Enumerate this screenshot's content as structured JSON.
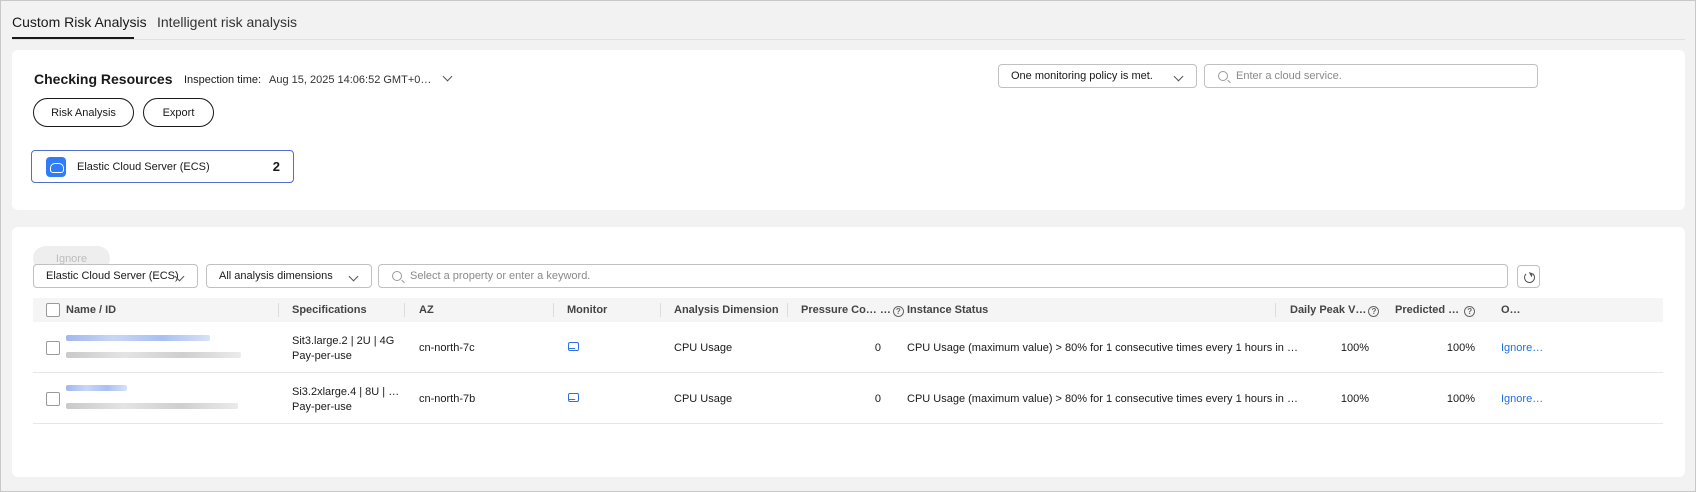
{
  "tabs": [
    {
      "label": "Custom Risk Analysis",
      "active": true
    },
    {
      "label": "Intelligent risk analysis",
      "active": false
    }
  ],
  "resources": {
    "title": "Checking Resources",
    "inspection_label": "Inspection time:",
    "inspection_time": "Aug 15, 2025 14:06:52 GMT+0…",
    "policy_select": "One monitoring policy is met.",
    "search_placeholder": "Enter a cloud service.",
    "risk_analysis_label": "Risk Analysis",
    "export_label": "Export",
    "service": {
      "name": "Elastic Cloud Server (ECS)",
      "count": "2",
      "icon": "cloud-server-icon"
    }
  },
  "list": {
    "ignore_label": "Ignore",
    "service_filter": "Elastic Cloud Server (ECS)",
    "dimension_filter": "All analysis dimensions",
    "search_placeholder": "Select a property or enter a keyword.",
    "columns": {
      "name": "Name / ID",
      "spec": "Specifications",
      "az": "AZ",
      "monitor": "Monitor",
      "dimension": "Analysis Dimension",
      "pressure": "Pressure Co… …",
      "status": "Instance Status",
      "daily_peak": "Daily Peak V…",
      "predicted": "Predicted …",
      "operation": "O…"
    },
    "rows": [
      {
        "spec_line1": "Sit3.large.2 | 2U | 4G",
        "spec_line2": "Pay-per-use",
        "az": "cn-north-7c",
        "dimension": "CPU Usage",
        "pressure": "0",
        "status": "CPU Usage (maximum value) > 80% for 1 consecutive times every 1 hours in …",
        "daily_peak": "100%",
        "predicted": "100%",
        "action": "Ignore…"
      },
      {
        "spec_line1": "Si3.2xlarge.4 | 8U | …",
        "spec_line2": "Pay-per-use",
        "az": "cn-north-7b",
        "dimension": "CPU Usage",
        "pressure": "0",
        "status": "CPU Usage (maximum value) > 80% for 1 consecutive times every 1 hours in …",
        "daily_peak": "100%",
        "predicted": "100%",
        "action": "Ignore…"
      }
    ]
  },
  "colors": {
    "accent": "#1f6fe0",
    "selected_border": "#526ecc",
    "page_bg": "#f2f2f2"
  }
}
